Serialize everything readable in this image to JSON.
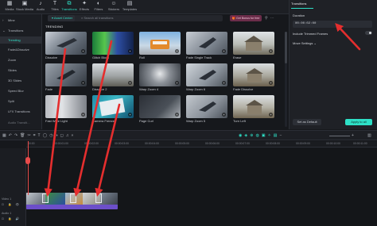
{
  "toolbar": {
    "items": [
      {
        "label": "Media",
        "icon": "media-icon"
      },
      {
        "label": "Stock Media",
        "icon": "stock-media-icon"
      },
      {
        "label": "Audio",
        "icon": "audio-icon"
      },
      {
        "label": "Titles",
        "icon": "titles-icon"
      },
      {
        "label": "Transitions",
        "icon": "transitions-icon",
        "active": true
      },
      {
        "label": "Effects",
        "icon": "effects-icon"
      },
      {
        "label": "Filters",
        "icon": "filters-icon"
      },
      {
        "label": "Stickers",
        "icon": "stickers-icon"
      },
      {
        "label": "Templates",
        "icon": "templates-icon"
      }
    ]
  },
  "sidebar": {
    "items": [
      {
        "label": "Mine",
        "icon": "chevron-right-icon"
      },
      {
        "label": "Transitions",
        "icon": "chevron-down-icon"
      },
      {
        "label": "Trending",
        "active": true
      },
      {
        "label": "Fade&Dissolve"
      },
      {
        "label": "Zoom"
      },
      {
        "label": "Slides"
      },
      {
        "label": "3D Slides"
      },
      {
        "label": "Speed Blur"
      },
      {
        "label": "Split"
      },
      {
        "label": "LFX Transitions"
      },
      {
        "label": "Audio Transiti..."
      }
    ]
  },
  "search": {
    "asset_center": "Asset Center",
    "placeholder": "Search all transitions"
  },
  "promo": {
    "label": "Get Bonus for free"
  },
  "section_title": "TRENDING",
  "transitions": [
    {
      "name": "Dissolve"
    },
    {
      "name": "Glitch Block"
    },
    {
      "name": "Roll"
    },
    {
      "name": "Fade Single Track"
    },
    {
      "name": "Erase"
    },
    {
      "name": "Fade"
    },
    {
      "name": "Dissolve 2"
    },
    {
      "name": "Warp Zoom 4"
    },
    {
      "name": "Warp Zoom 6"
    },
    {
      "name": "Fade Dissolve"
    },
    {
      "name": "Fast Wipe Light"
    },
    {
      "name": "Camera Freeze"
    },
    {
      "name": "Page Curl"
    },
    {
      "name": "Warp Zoom 5"
    },
    {
      "name": "Turn Left"
    }
  ],
  "right_panel": {
    "tab": "Transitions",
    "duration_label": "Duration",
    "duration_value": "00:00:02:00",
    "trimmed_label": "Include Trimmed Frames",
    "trimmed_on": false,
    "more_settings": "Move Settings",
    "set_default": "Set as Default",
    "apply_all": "Apply to all"
  },
  "timeline": {
    "ticks": [
      "00:00",
      "00:00:01:00",
      "00:00:02:00",
      "00:00:03:00",
      "00:00:04:00",
      "00:00:05:00",
      "00:00:06:00",
      "00:00:07:00",
      "00:00:08:00",
      "00:00:09:00",
      "00:00:10:00",
      "00:00:11:00"
    ],
    "track_video_label": "Video 1",
    "track_audio_label": "Audio 1"
  },
  "colors": {
    "accent": "#2ee0c6",
    "arrow": "#e52e2e",
    "audio_bar": "#6c4fc9",
    "playhead": "#e84b4b"
  }
}
